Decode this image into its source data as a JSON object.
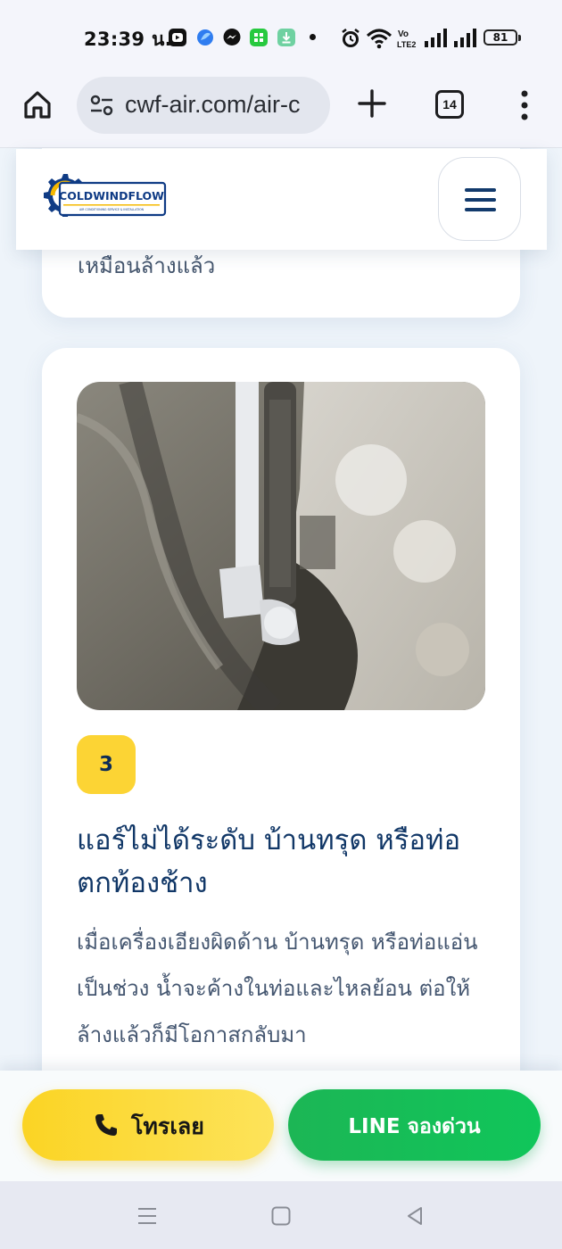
{
  "status_bar": {
    "time": "23:39 น.",
    "battery": "81",
    "icons": [
      "media-app-icon",
      "browser-app-icon",
      "messenger-icon",
      "calculator-app-icon",
      "download-icon",
      "dot-icon",
      "alarm-icon",
      "wifi-icon",
      "volte-icon",
      "signal-icon",
      "signal-icon",
      "battery-icon"
    ]
  },
  "browser": {
    "url": "cwf-air.com/air-c",
    "tab_count": "14"
  },
  "site_header": {
    "logo_text": "COLDWINDFLOW",
    "logo_tagline": "AIR CONDITIONING SERVICE & INSTALLATION"
  },
  "previous_card": {
    "text_tail": "เหมือนล้างแล้ว"
  },
  "card": {
    "number": "3",
    "title": "แอร์ไม่ได้ระดับ บ้านทรุด หรือท่อตกท้องช้าง",
    "body": "เมื่อเครื่องเอียงผิดด้าน บ้านทรุด หรือท่อแอ่นเป็นช่วง น้ำจะค้างในท่อและไหลย้อน ต่อให้ล้างแล้วก็มีโอกาสกลับมา",
    "photo": "air-conditioner-drain-pipe-photo"
  },
  "cta": {
    "call_label": "โทรเลย",
    "line_label": "LINE จองด่วน"
  },
  "colors": {
    "brand_navy": "#113767",
    "badge_yellow": "#fcd434",
    "line_green": "#10c65a",
    "call_yellow": "#fbd424"
  }
}
